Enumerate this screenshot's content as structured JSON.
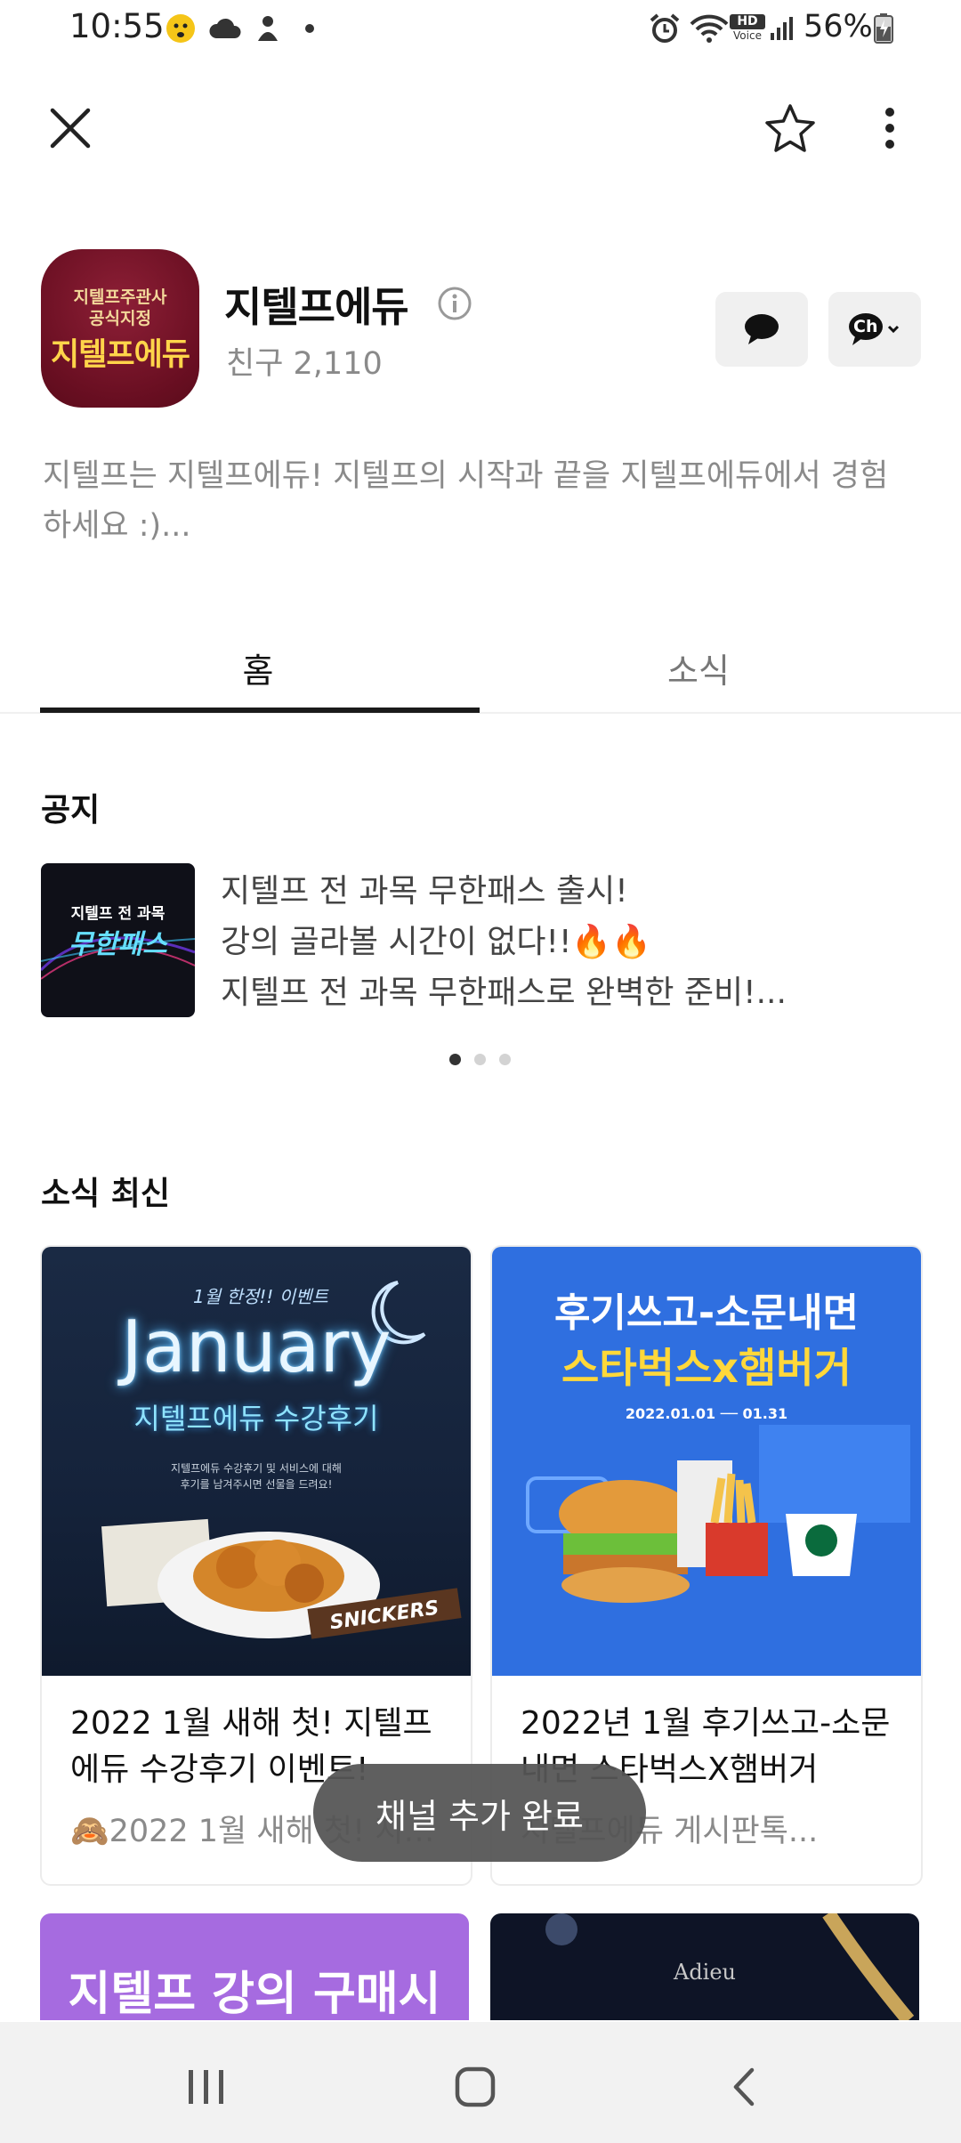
{
  "status_bar": {
    "time": "10:55",
    "battery": "56%",
    "hd_label": "HD",
    "voice_label": "Voice"
  },
  "channel": {
    "logo_line1": "지텔프주관사",
    "logo_line2": "공식지정",
    "logo_line3": "지텔프에듀",
    "name": "지텔프에듀",
    "friends": "친구 2,110",
    "description": "지텔프는 지텔프에듀! 지텔프의 시작과 끝을 지텔프에듀에서 경험하세요 :)...",
    "chat_button_label": "Ch"
  },
  "tabs": [
    {
      "label": "홈"
    },
    {
      "label": "소식"
    }
  ],
  "notice": {
    "section_title": "공지",
    "thumb_line1": "지텔프 전 과목",
    "thumb_line2": "무한패스",
    "lines": [
      "지텔프 전 과목 무한패스 출시!",
      "강의 골라볼 시간이 없다!!🔥🔥",
      "지텔프 전 과목 무한패스로 완벽한 준비!..."
    ]
  },
  "news": {
    "section_title": "소식 최신",
    "cards": [
      {
        "img_script": "1월 한정!! 이벤트",
        "img_title": "January",
        "img_subtitle": "지텔프에듀 수강후기",
        "img_caption1": "지텔프에듀 수강후기 및 서비스에 대해",
        "img_caption2": "후기를 남겨주시면 선물을 드려요!",
        "img_snickers": "SNICKERS",
        "title": "2022 1월 새해 첫! 지텔프에듀 수강후기 이벤트!",
        "meta": "🙈2022 1월 새해 첫! 지텔프"
      },
      {
        "img_line1": "후기쓰고-소문내면",
        "img_line2": "스타벅스x햄버거",
        "img_dates": "2022.01.01 ── 01.31",
        "title": "2022년 1월 후기쓰고-소문내면 스타벅스X햄버거",
        "meta": "지텔프에듀 게시판톡..."
      }
    ],
    "row2": [
      {
        "img_text": "지텔프 강의 구매시"
      },
      {
        "img_text": "Adieu"
      }
    ]
  },
  "toast": {
    "text": "채널 추가 완료"
  },
  "colors": {
    "logo_bg": "#6a0f22",
    "tab_underline": "#1a1a1a",
    "toast_bg": "#555555",
    "card2_bg": "#2f6fe0"
  }
}
